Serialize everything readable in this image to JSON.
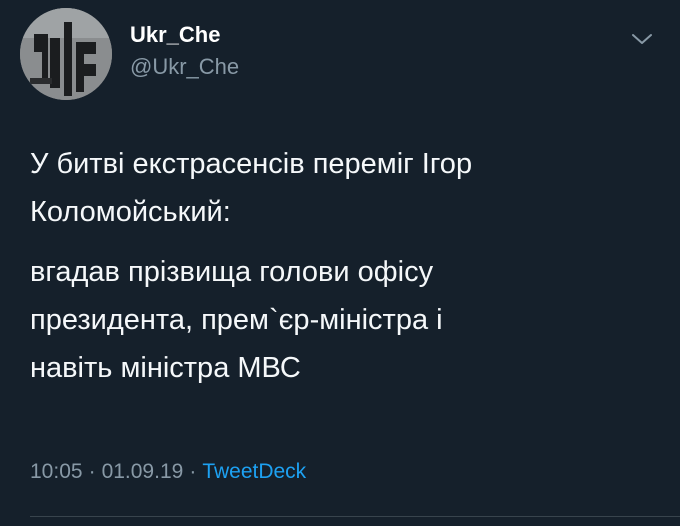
{
  "author": {
    "display_name": "Ukr_Che",
    "handle": "@Ukr_Che",
    "avatar_icon": "logo-avatar"
  },
  "menu": {
    "icon": "chevron-down-icon"
  },
  "tweet": {
    "line_1": "У битві екстрасенсів переміг Ігор",
    "line_2": "Коломойський:",
    "line_3": "вгадав прізвища голови офісу",
    "line_4": "президента, прем`єр-міністра і",
    "line_5": "навіть міністра МВС"
  },
  "meta": {
    "time": "10:05",
    "separator_1": "·",
    "date": "01.09.19",
    "separator_2": "·",
    "source": "TweetDeck"
  },
  "colors": {
    "background": "#15202b",
    "secondary_text": "#8899a6",
    "link": "#1da1f2",
    "primary_text": "#ffffff"
  }
}
